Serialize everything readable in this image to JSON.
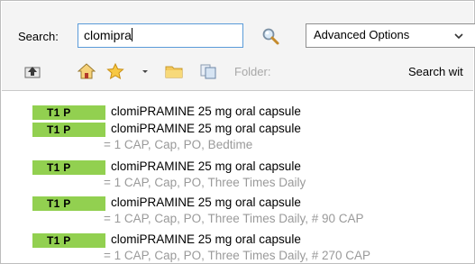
{
  "search": {
    "label": "Search:",
    "value": "clomipra",
    "button_icon": "magnifier-icon"
  },
  "advanced_options": {
    "label": "Advanced Options",
    "icon": "chevron-down-icon"
  },
  "toolbar": {
    "icons": [
      "up-folder-icon",
      "home-icon",
      "favorite-star-icon",
      "dropdown-arrow-icon",
      "folder-icon",
      "copy-icon"
    ],
    "folder_label": "Folder:",
    "search_within_label": "Search wit"
  },
  "results": [
    {
      "badge": "T1 P",
      "name": "clomiPRAMINE 25 mg oral capsule"
    },
    {
      "badge": "T1 P",
      "name": "clomiPRAMINE 25 mg oral capsule",
      "sig": "= 1 CAP, Cap, PO, Bedtime"
    },
    {
      "badge": "T1 P",
      "name": "clomiPRAMINE 25 mg oral capsule",
      "sig": "= 1 CAP, Cap, PO, Three Times Daily"
    },
    {
      "badge": "T1 P",
      "name": "clomiPRAMINE 25 mg oral capsule",
      "sig": "= 1 CAP, Cap, PO, Three Times Daily, # 90 CAP"
    },
    {
      "badge": "T1 P",
      "name": "clomiPRAMINE 25 mg oral capsule",
      "sig": "= 1 CAP, Cap, PO, Three Times Daily, # 270 CAP"
    }
  ],
  "colors": {
    "badge": "#92d050",
    "sig_text": "#9a9a9a",
    "input_border": "#5a9bd8"
  }
}
